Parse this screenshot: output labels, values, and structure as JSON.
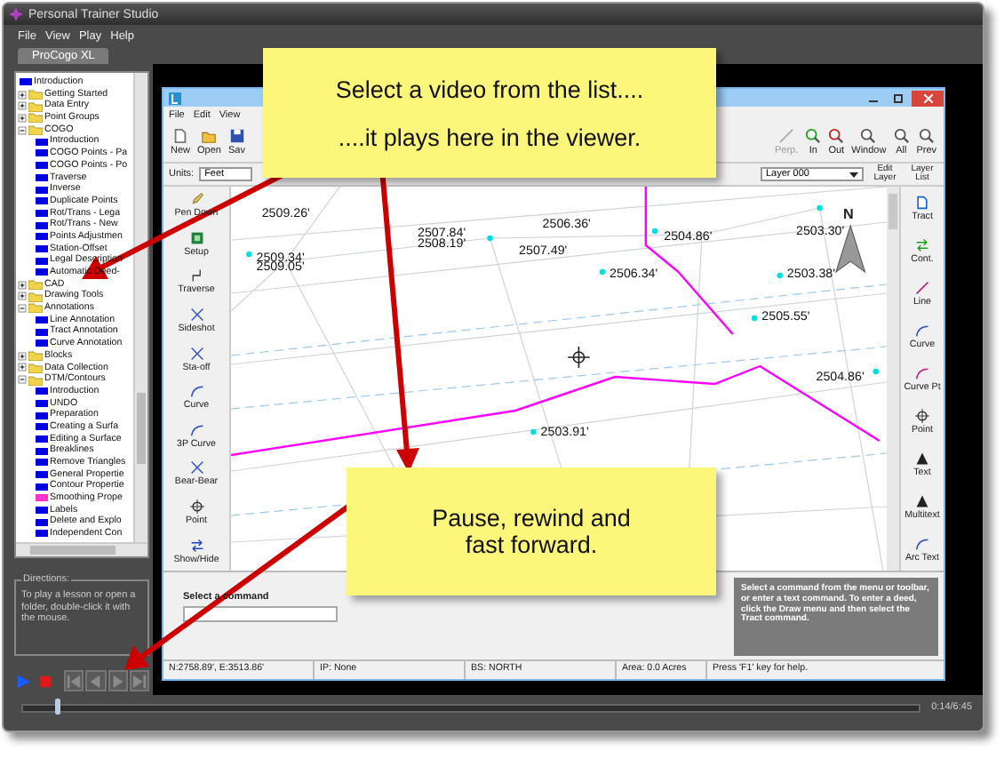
{
  "window": {
    "title": "Personal Trainer Studio"
  },
  "menu": [
    "File",
    "View",
    "Play",
    "Help"
  ],
  "tabs": [
    {
      "label": "ProCogo XL",
      "selected": true
    }
  ],
  "tree": [
    {
      "label": "Introduction",
      "kind": "lesson",
      "color": "#0000e0"
    },
    {
      "label": "Getting Started",
      "kind": "folder",
      "expanded": false
    },
    {
      "label": "Data Entry",
      "kind": "folder",
      "expanded": false
    },
    {
      "label": "Point Groups",
      "kind": "folder",
      "expanded": false
    },
    {
      "label": "COGO",
      "kind": "folder",
      "expanded": true,
      "children": [
        {
          "label": "Introduction",
          "kind": "lesson",
          "color": "#0000e0"
        },
        {
          "label": "COGO Points - Pa",
          "kind": "lesson",
          "color": "#0000e0"
        },
        {
          "label": "COGO Points - Po",
          "kind": "lesson",
          "color": "#0000e0"
        },
        {
          "label": "Traverse",
          "kind": "lesson",
          "color": "#0000e0"
        },
        {
          "label": "Inverse",
          "kind": "lesson",
          "color": "#0000e0"
        },
        {
          "label": "Duplicate Points",
          "kind": "lesson",
          "color": "#0000e0"
        },
        {
          "label": "Rot/Trans - Lega",
          "kind": "lesson",
          "color": "#0000e0"
        },
        {
          "label": "Rot/Trans - New",
          "kind": "lesson",
          "color": "#0000e0"
        },
        {
          "label": "Points Adjustmen",
          "kind": "lesson",
          "color": "#0000e0"
        },
        {
          "label": "Station-Offset",
          "kind": "lesson",
          "color": "#0000e0"
        },
        {
          "label": "Legal Description",
          "kind": "lesson",
          "color": "#0000e0"
        },
        {
          "label": "Automatic Deed-",
          "kind": "lesson",
          "color": "#0000e0"
        }
      ]
    },
    {
      "label": "CAD",
      "kind": "folder",
      "expanded": false
    },
    {
      "label": "Drawing Tools",
      "kind": "folder",
      "expanded": false
    },
    {
      "label": "Annotations",
      "kind": "folder",
      "expanded": true,
      "children": [
        {
          "label": "Line Annotation",
          "kind": "lesson",
          "color": "#0000e0"
        },
        {
          "label": "Tract Annotation",
          "kind": "lesson",
          "color": "#0000e0"
        },
        {
          "label": "Curve Annotation",
          "kind": "lesson",
          "color": "#0000e0"
        }
      ]
    },
    {
      "label": "Blocks",
      "kind": "folder",
      "expanded": false
    },
    {
      "label": "Data Collection",
      "kind": "folder",
      "expanded": false
    },
    {
      "label": "DTM/Contours",
      "kind": "folder",
      "expanded": true,
      "children": [
        {
          "label": "Introduction",
          "kind": "lesson",
          "color": "#0000e0"
        },
        {
          "label": "UNDO",
          "kind": "lesson",
          "color": "#0000e0"
        },
        {
          "label": "Preparation",
          "kind": "lesson",
          "color": "#0000e0"
        },
        {
          "label": "Creating a Surfa",
          "kind": "lesson",
          "color": "#0000e0"
        },
        {
          "label": "Editing a Surface",
          "kind": "lesson",
          "color": "#0000e0"
        },
        {
          "label": "Breaklines",
          "kind": "lesson",
          "color": "#0000e0"
        },
        {
          "label": "Remove Triangles",
          "kind": "lesson",
          "color": "#0000e0"
        },
        {
          "label": "General Propertie",
          "kind": "lesson",
          "color": "#0000e0"
        },
        {
          "label": "Contour Propertie",
          "kind": "lesson",
          "color": "#0000e0"
        },
        {
          "label": "Smoothing Prope",
          "kind": "lesson",
          "color": "#ff33cc"
        },
        {
          "label": "Labels",
          "kind": "lesson",
          "color": "#0000e0"
        },
        {
          "label": "Delete and Explo",
          "kind": "lesson",
          "color": "#0000e0"
        },
        {
          "label": "Independent Con",
          "kind": "lesson",
          "color": "#0000e0"
        }
      ]
    }
  ],
  "directions": {
    "title": "Directions:",
    "text": "To play a lesson or open a folder, double-click it with the mouse."
  },
  "player": {
    "buttons": [
      {
        "kind": "play",
        "disabled": false
      },
      {
        "kind": "stop",
        "disabled": false
      },
      {
        "kind": "start",
        "disabled": true
      },
      {
        "kind": "back",
        "disabled": true
      },
      {
        "kind": "forward",
        "disabled": true
      },
      {
        "kind": "end",
        "disabled": true
      }
    ],
    "position": {
      "level": 0.035
    },
    "time": "0:14/6:45"
  },
  "viewer": {
    "menu": [
      "File",
      "Edit",
      "View"
    ],
    "toolbar_left": [
      {
        "label": "New",
        "kind": "new"
      },
      {
        "label": "Open",
        "kind": "open"
      },
      {
        "label": "Sav",
        "kind": "save"
      }
    ],
    "toolbar_right": [
      {
        "label": "Perp.",
        "kind": "perp",
        "disabled": true
      },
      {
        "label": "In",
        "kind": "in",
        "disabled": false
      },
      {
        "label": "Out",
        "kind": "out",
        "disabled": false
      },
      {
        "label": "Window",
        "kind": "window",
        "disabled": false
      },
      {
        "label": "All",
        "kind": "all",
        "disabled": false
      },
      {
        "label": "Prev",
        "kind": "prev",
        "disabled": false
      }
    ],
    "units": {
      "label": "Units:",
      "value": "Feet"
    },
    "layer": {
      "value": "Layer 000"
    },
    "layer_buttons": [
      "Edit Layer",
      "Layer List"
    ],
    "left_tools": [
      {
        "label": "Pen Down",
        "kind": "pen"
      },
      {
        "label": "Setup",
        "kind": "setup"
      },
      {
        "label": "Traverse",
        "kind": "traverse"
      },
      {
        "label": "Sideshot",
        "kind": "sideshot"
      },
      {
        "label": "Sta-off",
        "kind": "staoff"
      },
      {
        "label": "Curve",
        "kind": "curve"
      },
      {
        "label": "3P Curve",
        "kind": "curve3p"
      },
      {
        "label": "Bear-Bear",
        "kind": "bearbear"
      },
      {
        "label": "Point",
        "kind": "point"
      },
      {
        "label": "Show/Hide",
        "kind": "showhide"
      }
    ],
    "right_tools": [
      {
        "label": "Tract",
        "kind": "tract"
      },
      {
        "label": "Cont.",
        "kind": "cont"
      },
      {
        "label": "Line",
        "kind": "line"
      },
      {
        "label": "Curve",
        "kind": "curve"
      },
      {
        "label": "Curve Pt",
        "kind": "curvept"
      },
      {
        "label": "Point",
        "kind": "point"
      },
      {
        "label": "Text",
        "kind": "text"
      },
      {
        "label": "Multitext",
        "kind": "multitext"
      },
      {
        "label": "Arc Text",
        "kind": "arctext"
      }
    ],
    "map_labels": [
      "2509.26'",
      "2507.84'",
      "2508.19'",
      "2506.36'",
      "2504.86'",
      "2503.30'",
      "2509.34'",
      "2509.05'",
      "2507.49'",
      "2506.34'",
      "2503.38'",
      "2505.55'",
      "2504.86'",
      "2503.91'"
    ],
    "compass": "N",
    "command": {
      "label": "Select a command"
    },
    "help": "Select a command from the menu or toolbar, or enter a text command. To enter a deed, click the Draw menu and then select the Tract command.",
    "status": [
      "N:2758.89', E:3513.86'",
      "IP: None",
      "BS: NORTH",
      "Area: 0.0 Acres",
      "Press 'F1' key for help."
    ]
  },
  "callouts": [
    {
      "lines": [
        "Select a video from the list....",
        "....it plays here in the viewer."
      ]
    },
    {
      "lines": [
        "Pause, rewind and fast forward."
      ]
    }
  ]
}
